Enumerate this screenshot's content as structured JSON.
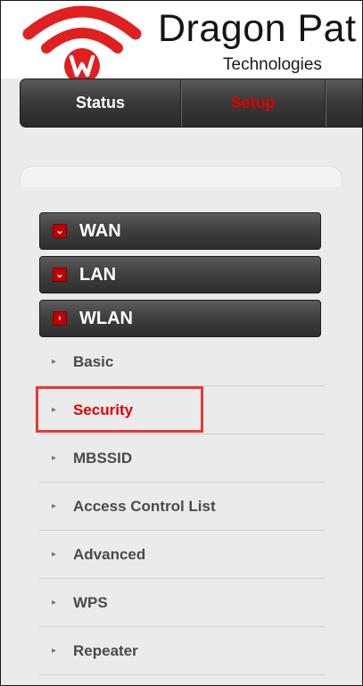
{
  "brand": {
    "name": "Dragon Pat",
    "subtitle": "Technologies",
    "logo_icon": "wifi-w-logo",
    "accent_color": "#e02020"
  },
  "topnav": {
    "tabs": [
      {
        "label": "Status",
        "active": false
      },
      {
        "label": "Setup",
        "active": true
      }
    ]
  },
  "menu": {
    "groups": [
      {
        "label": "WAN",
        "state": "collapsed"
      },
      {
        "label": "LAN",
        "state": "collapsed"
      },
      {
        "label": "WLAN",
        "state": "expanded"
      }
    ],
    "wlan_items": [
      {
        "label": "Basic"
      },
      {
        "label": "Security",
        "selected": true
      },
      {
        "label": "MBSSID"
      },
      {
        "label": "Access Control List"
      },
      {
        "label": "Advanced"
      },
      {
        "label": "WPS"
      },
      {
        "label": "Repeater"
      }
    ]
  },
  "colors": {
    "selected_text": "#e00000",
    "highlight_border": "#e53935",
    "nav_dark": "#3a3a3a"
  }
}
